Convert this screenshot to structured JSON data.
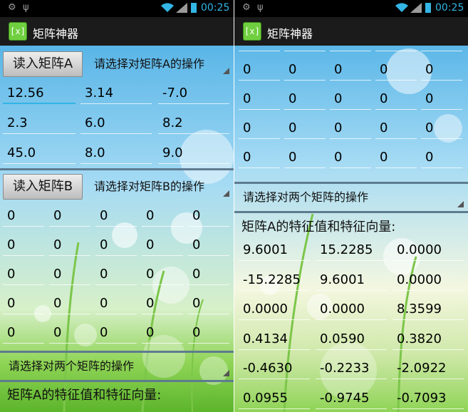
{
  "status": {
    "time": "00:25"
  },
  "app": {
    "title": "矩阵神器",
    "icon_text": "[x]"
  },
  "matrixA": {
    "load_label": "读入矩阵A",
    "op_placeholder": "请选择对矩阵A的操作",
    "rows": [
      [
        "12.56",
        "3.14",
        "-7.0"
      ],
      [
        "2.3",
        "6.0",
        "8.2"
      ],
      [
        "45.0",
        "8.0",
        "9.0"
      ]
    ]
  },
  "matrixB": {
    "load_label": "读入矩阵B",
    "op_placeholder": "请选择对矩阵B的操作",
    "rows": [
      [
        "0",
        "0",
        "0",
        "0",
        "0"
      ],
      [
        "0",
        "0",
        "0",
        "0",
        "0"
      ],
      [
        "0",
        "0",
        "0",
        "0",
        "0"
      ],
      [
        "0",
        "0",
        "0",
        "0",
        "0"
      ],
      [
        "0",
        "0",
        "0",
        "0",
        "0"
      ]
    ]
  },
  "two_matrix_op": "请选择对两个矩阵的操作",
  "result_label": "矩阵A的特征值和特征向量:",
  "result_values": [
    [
      "9.6001",
      "15.2285",
      "0.0000"
    ],
    [
      "-15.2285",
      "9.6001",
      "0.0000"
    ],
    [
      "0.0000",
      "0.0000",
      "8.3599"
    ],
    [
      "0.4134",
      "0.0590",
      "0.3820"
    ],
    [
      "-0.4630",
      "-0.2233",
      "-2.0922"
    ],
    [
      "0.0955",
      "-0.9745",
      "-0.7093"
    ]
  ],
  "colors": {
    "accent": "#33b5e5",
    "app_icon": "#6fcf3f",
    "actionbar": "#1b1b1b"
  }
}
